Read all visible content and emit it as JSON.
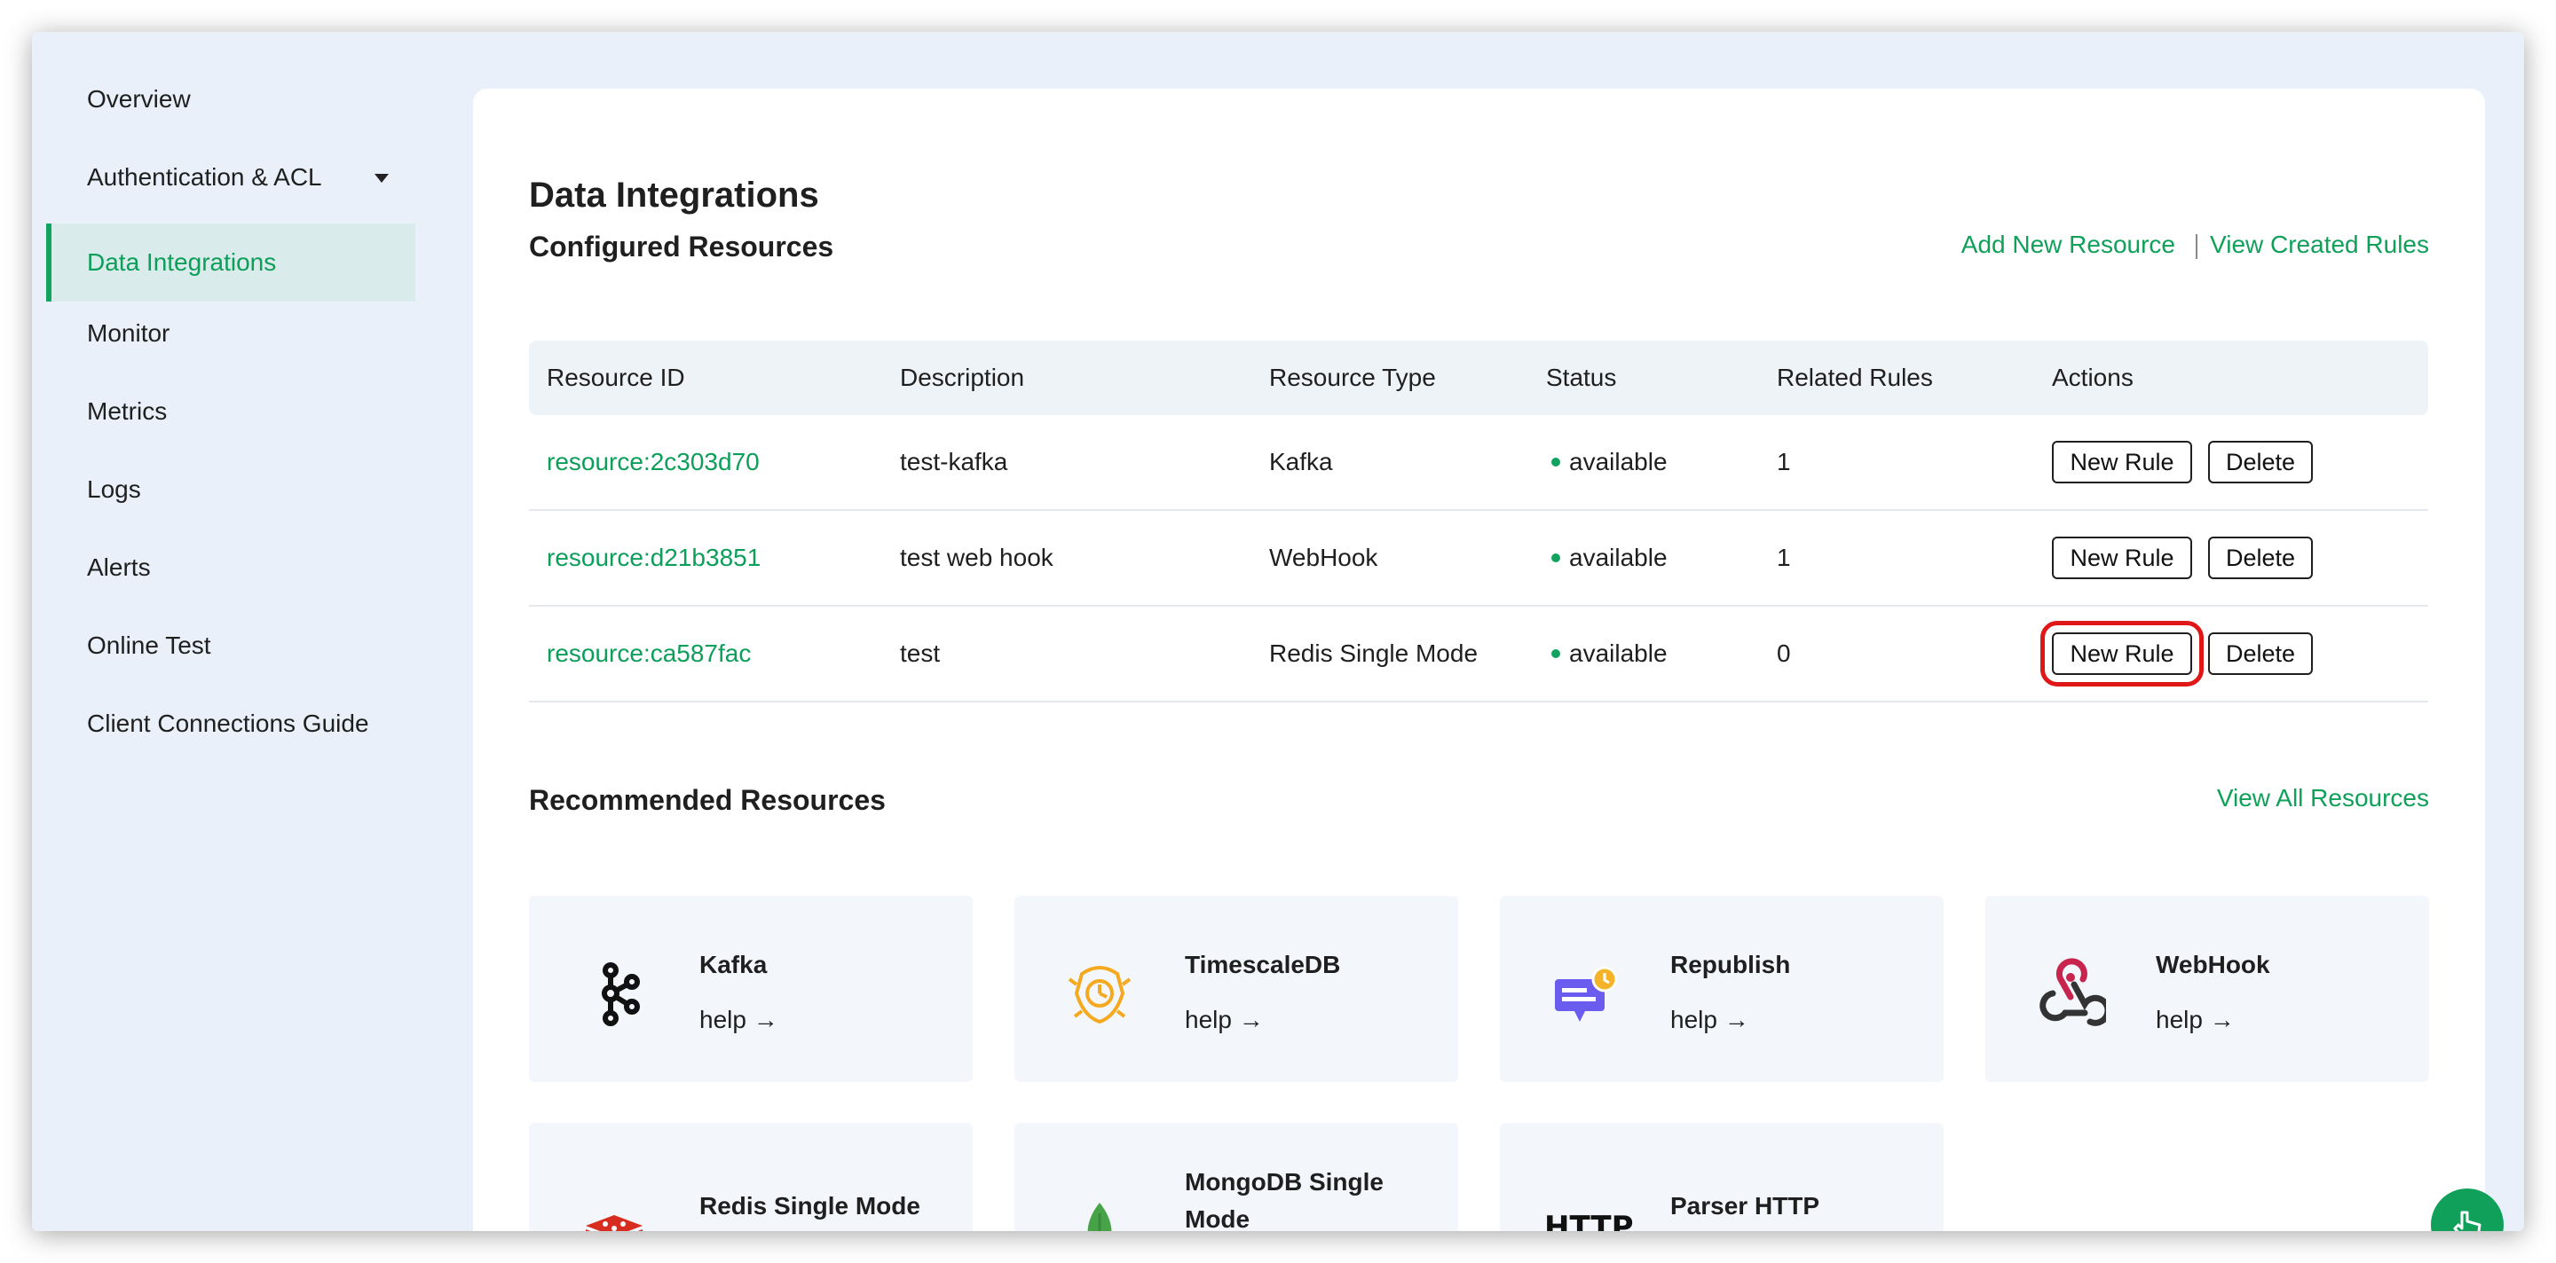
{
  "sidebar": {
    "items": [
      {
        "label": "Overview"
      },
      {
        "label": "Authentication & ACL"
      },
      {
        "label": "Data Integrations"
      },
      {
        "label": "Monitor"
      },
      {
        "label": "Metrics"
      },
      {
        "label": "Logs"
      },
      {
        "label": "Alerts"
      },
      {
        "label": "Online Test"
      },
      {
        "label": "Client Connections Guide"
      }
    ],
    "active_item": "Data Integrations"
  },
  "main": {
    "title": "Data Integrations",
    "configured": {
      "title": "Configured Resources",
      "add_link": "Add New Resource",
      "view_link": "View Created Rules",
      "columns": [
        "Resource ID",
        "Description",
        "Resource Type",
        "Status",
        "Related Rules",
        "Actions"
      ],
      "rows": [
        {
          "id": "resource:2c303d70",
          "description": "test-kafka",
          "type": "Kafka",
          "status": "available",
          "related": "1"
        },
        {
          "id": "resource:d21b3851",
          "description": "test web hook",
          "type": "WebHook",
          "status": "available",
          "related": "1"
        },
        {
          "id": "resource:ca587fac",
          "description": "test",
          "type": "Redis Single Mode",
          "status": "available",
          "related": "0"
        }
      ],
      "new_rule_label": "New Rule",
      "delete_label": "Delete"
    },
    "recommended": {
      "title": "Recommended Resources",
      "view_all": "View All Resources",
      "help_label": "help →",
      "cards": [
        {
          "name": "Kafka",
          "icon": "kafka-icon"
        },
        {
          "name": "TimescaleDB",
          "icon": "timescaledb-icon"
        },
        {
          "name": "Republish",
          "icon": "republish-icon"
        },
        {
          "name": "WebHook",
          "icon": "webhook-icon"
        },
        {
          "name": "Redis Single Mode",
          "icon": "redis-icon"
        },
        {
          "name": "MongoDB Single Mode",
          "icon": "mongodb-icon"
        },
        {
          "name": "Parser HTTP",
          "icon": "http-icon",
          "icon_text": "HTTP"
        }
      ]
    }
  },
  "colors": {
    "accent": "#10a05a",
    "background": "#e9f0f9",
    "highlight": "#e01717"
  }
}
